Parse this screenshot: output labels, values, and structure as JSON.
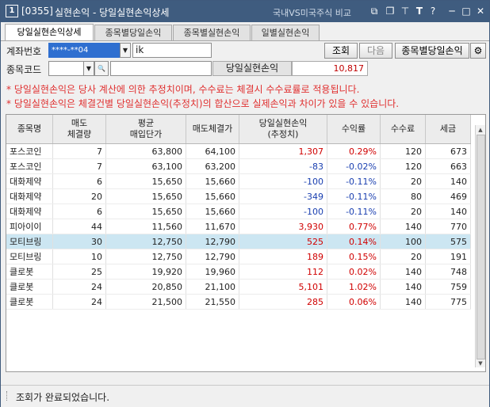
{
  "titlebar": {
    "code": "[0355]",
    "title": "실현손익 - 당일실현손익상세",
    "compare": "국내VS미국주식 비교",
    "icons": [
      "window-icon",
      "copy-icon",
      "pin-icon",
      "text-icon",
      "help-icon",
      "minimize-icon",
      "maximize-icon",
      "close-icon"
    ]
  },
  "tabs": [
    "당일실현손익상세",
    "종목별당일손익",
    "종목별실현손익",
    "일별실현손익"
  ],
  "form": {
    "account_label": "계좌번호",
    "account_value": "****-**04",
    "account_name": "ik",
    "stock_label": "종목코드",
    "stock_value": "",
    "stock_name": "",
    "query_btn": "조회",
    "next_btn": "다음",
    "per_stock_btn": "종목별당일손익",
    "pl_label": "당일실현손익",
    "pl_value": "10,817"
  },
  "notices": [
    "* 당일실현손익은 당사 계산에 의한 추정치이며, 수수료는 체결시 수수료률로 적용됩니다.",
    "* 당일실현손익은 체결건별 당일실현손익(추정치)의 합산으로 실제손익과 차이가 있을 수 있습니다."
  ],
  "table": {
    "headers": [
      [
        "종목명"
      ],
      [
        "매도",
        "체결량"
      ],
      [
        "평균",
        "매입단가"
      ],
      [
        "매도체결가"
      ],
      [
        "당일실현손익",
        "(추정치)"
      ],
      [
        "수익률"
      ],
      [
        "수수료"
      ],
      [
        "세금"
      ]
    ],
    "rows": [
      {
        "name": "포스코인",
        "qty": "7",
        "avg": "63,800",
        "sell": "64,100",
        "pl": "1,307",
        "rate": "0.29%",
        "fee": "120",
        "tax": "673",
        "sign": "pos"
      },
      {
        "name": "포스코인",
        "qty": "7",
        "avg": "63,100",
        "sell": "63,200",
        "pl": "-83",
        "rate": "-0.02%",
        "fee": "120",
        "tax": "663",
        "sign": "neg"
      },
      {
        "name": "대화제약",
        "qty": "6",
        "avg": "15,650",
        "sell": "15,660",
        "pl": "-100",
        "rate": "-0.11%",
        "fee": "20",
        "tax": "140",
        "sign": "neg"
      },
      {
        "name": "대화제약",
        "qty": "20",
        "avg": "15,650",
        "sell": "15,660",
        "pl": "-349",
        "rate": "-0.11%",
        "fee": "80",
        "tax": "469",
        "sign": "neg"
      },
      {
        "name": "대화제약",
        "qty": "6",
        "avg": "15,650",
        "sell": "15,660",
        "pl": "-100",
        "rate": "-0.11%",
        "fee": "20",
        "tax": "140",
        "sign": "neg"
      },
      {
        "name": "피아이이",
        "qty": "44",
        "avg": "11,560",
        "sell": "11,670",
        "pl": "3,930",
        "rate": "0.77%",
        "fee": "140",
        "tax": "770",
        "sign": "pos"
      },
      {
        "name": "모티브링",
        "qty": "30",
        "avg": "12,750",
        "sell": "12,790",
        "pl": "525",
        "rate": "0.14%",
        "fee": "100",
        "tax": "575",
        "sign": "pos"
      },
      {
        "name": "모티브링",
        "qty": "10",
        "avg": "12,750",
        "sell": "12,790",
        "pl": "189",
        "rate": "0.15%",
        "fee": "20",
        "tax": "191",
        "sign": "pos"
      },
      {
        "name": "클로봇",
        "qty": "25",
        "avg": "19,920",
        "sell": "19,960",
        "pl": "112",
        "rate": "0.02%",
        "fee": "140",
        "tax": "748",
        "sign": "pos"
      },
      {
        "name": "클로봇",
        "qty": "24",
        "avg": "20,850",
        "sell": "21,100",
        "pl": "5,101",
        "rate": "1.02%",
        "fee": "140",
        "tax": "759",
        "sign": "pos"
      },
      {
        "name": "클로봇",
        "qty": "24",
        "avg": "21,500",
        "sell": "21,550",
        "pl": "285",
        "rate": "0.06%",
        "fee": "140",
        "tax": "775",
        "sign": "pos"
      }
    ],
    "selected_row": 6
  },
  "status": "조회가 완료되었습니다.",
  "colors": {
    "titlebar": "#3f5c7f",
    "positive": "#d00000",
    "negative": "#1a3fb0",
    "selected_row": "#cce6f2",
    "account_highlight": "#2f6fd0"
  }
}
